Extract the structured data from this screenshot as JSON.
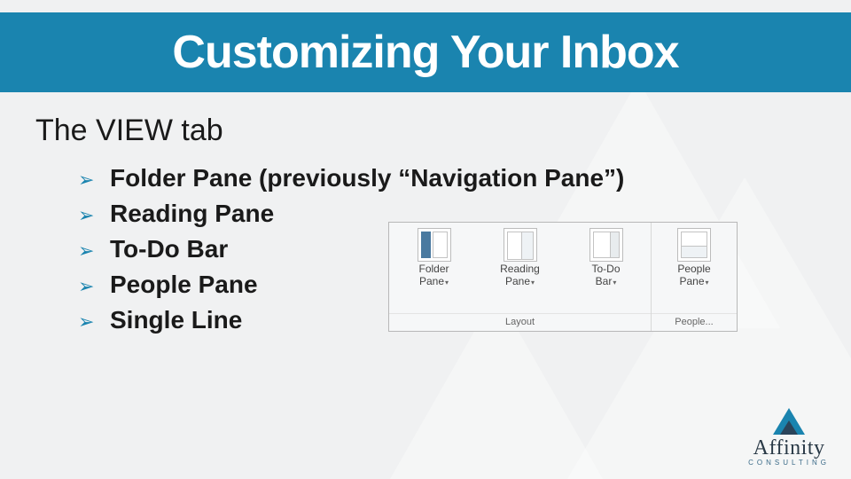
{
  "title": "Customizing Your Inbox",
  "subtitle": "The VIEW tab",
  "bullets": [
    "Folder Pane (previously “Navigation Pane”)",
    "Reading Pane",
    "To-Do Bar",
    "People Pane",
    "Single Line"
  ],
  "ribbon": {
    "group1": {
      "label": "Layout",
      "buttons": [
        {
          "line1": "Folder",
          "line2": "Pane"
        },
        {
          "line1": "Reading",
          "line2": "Pane"
        },
        {
          "line1": "To-Do",
          "line2": "Bar"
        }
      ]
    },
    "group2": {
      "label": "People...",
      "buttons": [
        {
          "line1": "People",
          "line2": "Pane"
        }
      ]
    }
  },
  "logo": {
    "word": "Affinity",
    "sub": "CONSULTING"
  }
}
